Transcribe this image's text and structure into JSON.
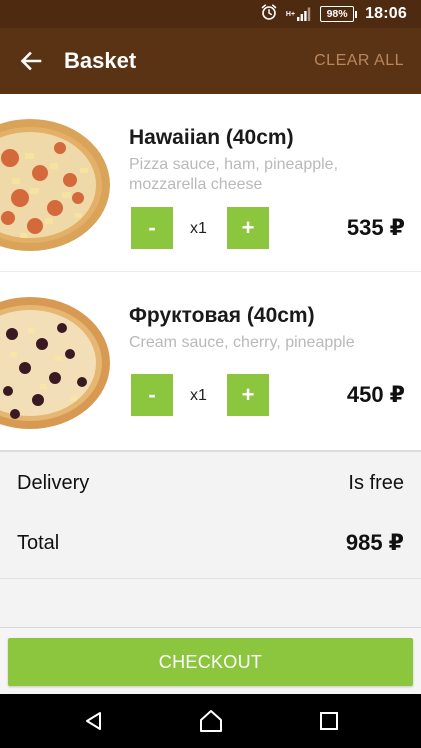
{
  "status_bar": {
    "battery": "98%",
    "time": "18:06",
    "network_label": "H+",
    "icons": [
      "alarm-icon",
      "signal-icon",
      "battery-icon"
    ]
  },
  "app_bar": {
    "title": "Basket",
    "clear_all": "CLEAR ALL",
    "back_icon": "arrow-left-icon"
  },
  "items": [
    {
      "name": "Hawaiian (40cm)",
      "description": "Pizza sauce, ham, pineapple, mozzarella cheese",
      "decrease_label": "-",
      "increase_label": "+",
      "quantity": "x1",
      "price": "535 ₽",
      "image_icon": "pizza-image"
    },
    {
      "name": "Фруктовая (40cm)",
      "description": "Cream sauce, cherry, pineapple",
      "decrease_label": "-",
      "increase_label": "+",
      "quantity": "x1",
      "price": "450 ₽",
      "image_icon": "pizza-image"
    }
  ],
  "summary": {
    "delivery_label": "Delivery",
    "delivery_value": "Is free",
    "total_label": "Total",
    "total_value": "985 ₽"
  },
  "checkout": {
    "label": "CHECKOUT"
  },
  "nav_bar": {
    "icons": [
      "back-triangle-icon",
      "home-circle-icon",
      "recents-square-icon"
    ]
  },
  "colors": {
    "status_bar": "#4e2a10",
    "app_bar": "#5a3214",
    "accent_green": "#8cc63f",
    "clear_all": "#b8875e",
    "description_gray": "#b9b9b9"
  }
}
